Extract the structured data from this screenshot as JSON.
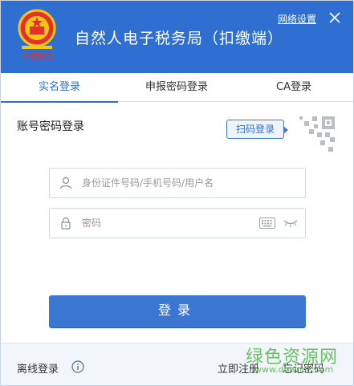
{
  "header": {
    "emblem_caption": "中国税务",
    "title": "自然人电子税务局（扣缴端）",
    "network_settings": "网络设置",
    "close_icon": "close-icon"
  },
  "tabs": [
    {
      "label": "实名登录",
      "active": true
    },
    {
      "label": "申报密码登录",
      "active": false
    },
    {
      "label": "CA登录",
      "active": false
    }
  ],
  "login": {
    "heading": "账号密码登录",
    "scan_button": "扫码登录",
    "id_placeholder": "身份证件号码/手机号码/用户名",
    "password_placeholder": "密码",
    "submit_label": "登录"
  },
  "footer": {
    "offline_login": "离线登录",
    "register": "立即注册",
    "forgot_password": "忘记密码"
  },
  "watermark": {
    "cn": "绿色资源网",
    "url": "www.downcc.com"
  },
  "colors": {
    "brand_blue": "#2f6fd1",
    "button_blue": "#3c76d3",
    "footer_bg": "#f2f6fb",
    "watermark_green": "#52b848"
  }
}
